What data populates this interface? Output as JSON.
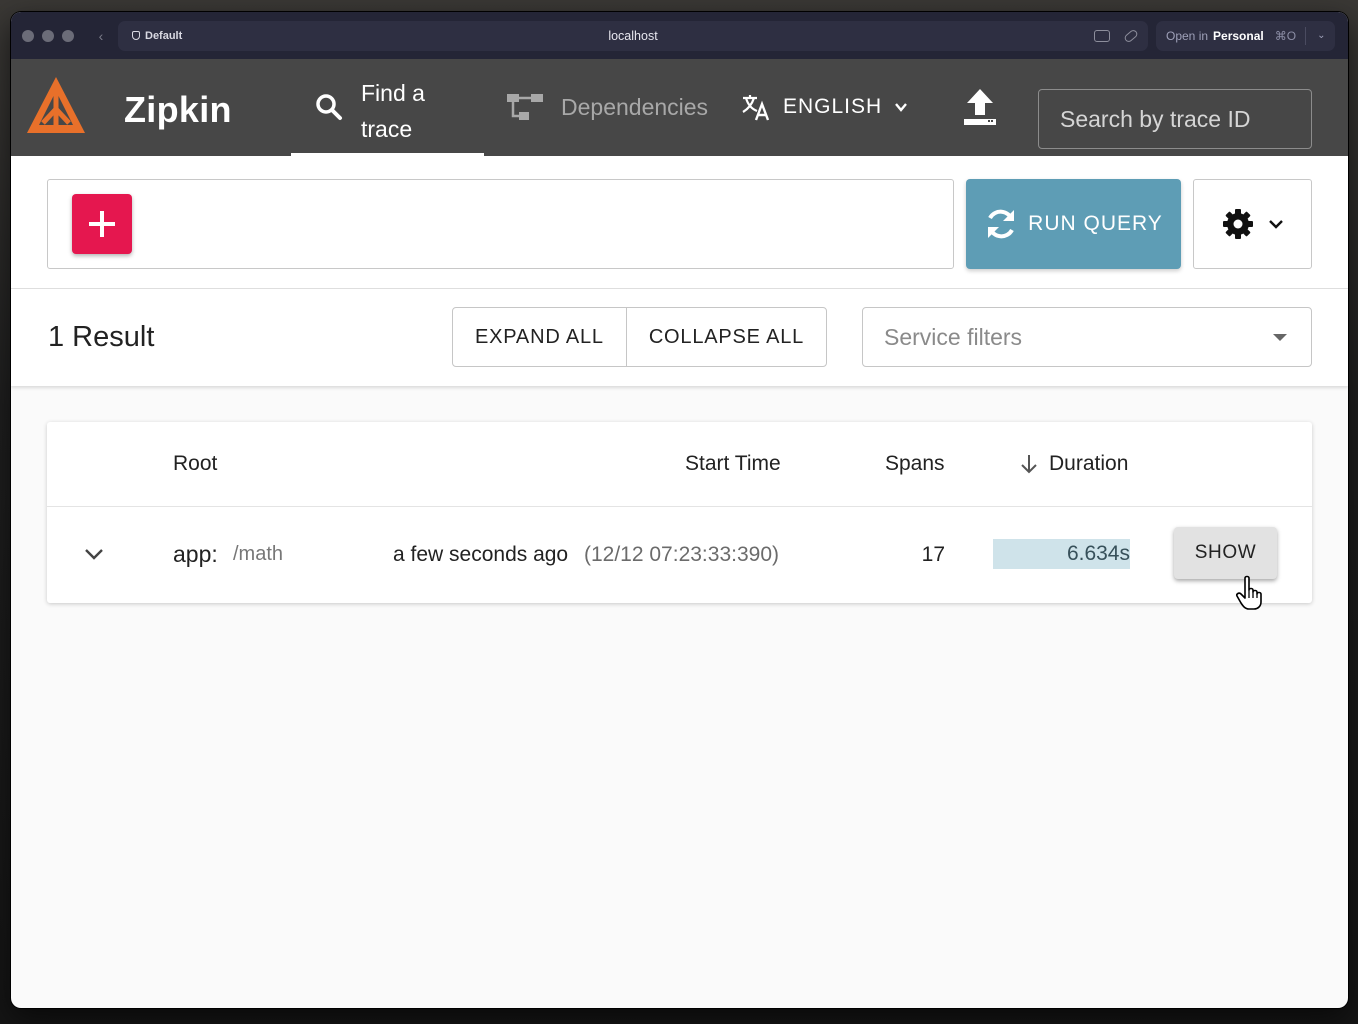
{
  "browser": {
    "profile": "Default",
    "url": "localhost",
    "open_in_prefix": "Open in",
    "open_in_target": "Personal",
    "open_in_shortcut": "⌘O"
  },
  "appbar": {
    "brand": "Zipkin",
    "nav": {
      "find_trace": "Find a trace",
      "dependencies": "Dependencies"
    },
    "language": "ENGLISH",
    "trace_search_placeholder": "Search by trace ID"
  },
  "query": {
    "run_label": "RUN QUERY"
  },
  "results": {
    "count_label": "1 Result",
    "expand_all": "EXPAND ALL",
    "collapse_all": "COLLAPSE ALL",
    "service_filter_placeholder": "Service filters"
  },
  "table": {
    "headers": {
      "root": "Root",
      "start_time": "Start Time",
      "spans": "Spans",
      "duration": "Duration"
    },
    "rows": [
      {
        "service": "app:",
        "span": "/math",
        "relative_time": "a few seconds ago",
        "absolute_time": "(12/12 07:23:33:390)",
        "spans": "17",
        "duration": "6.634s",
        "duration_fraction": 1.0,
        "action": "SHOW"
      }
    ]
  },
  "colors": {
    "appbar_bg": "#474747",
    "add_button": "#e5174f",
    "run_button": "#5e9db5",
    "duration_bar": "#cfe3ea"
  }
}
